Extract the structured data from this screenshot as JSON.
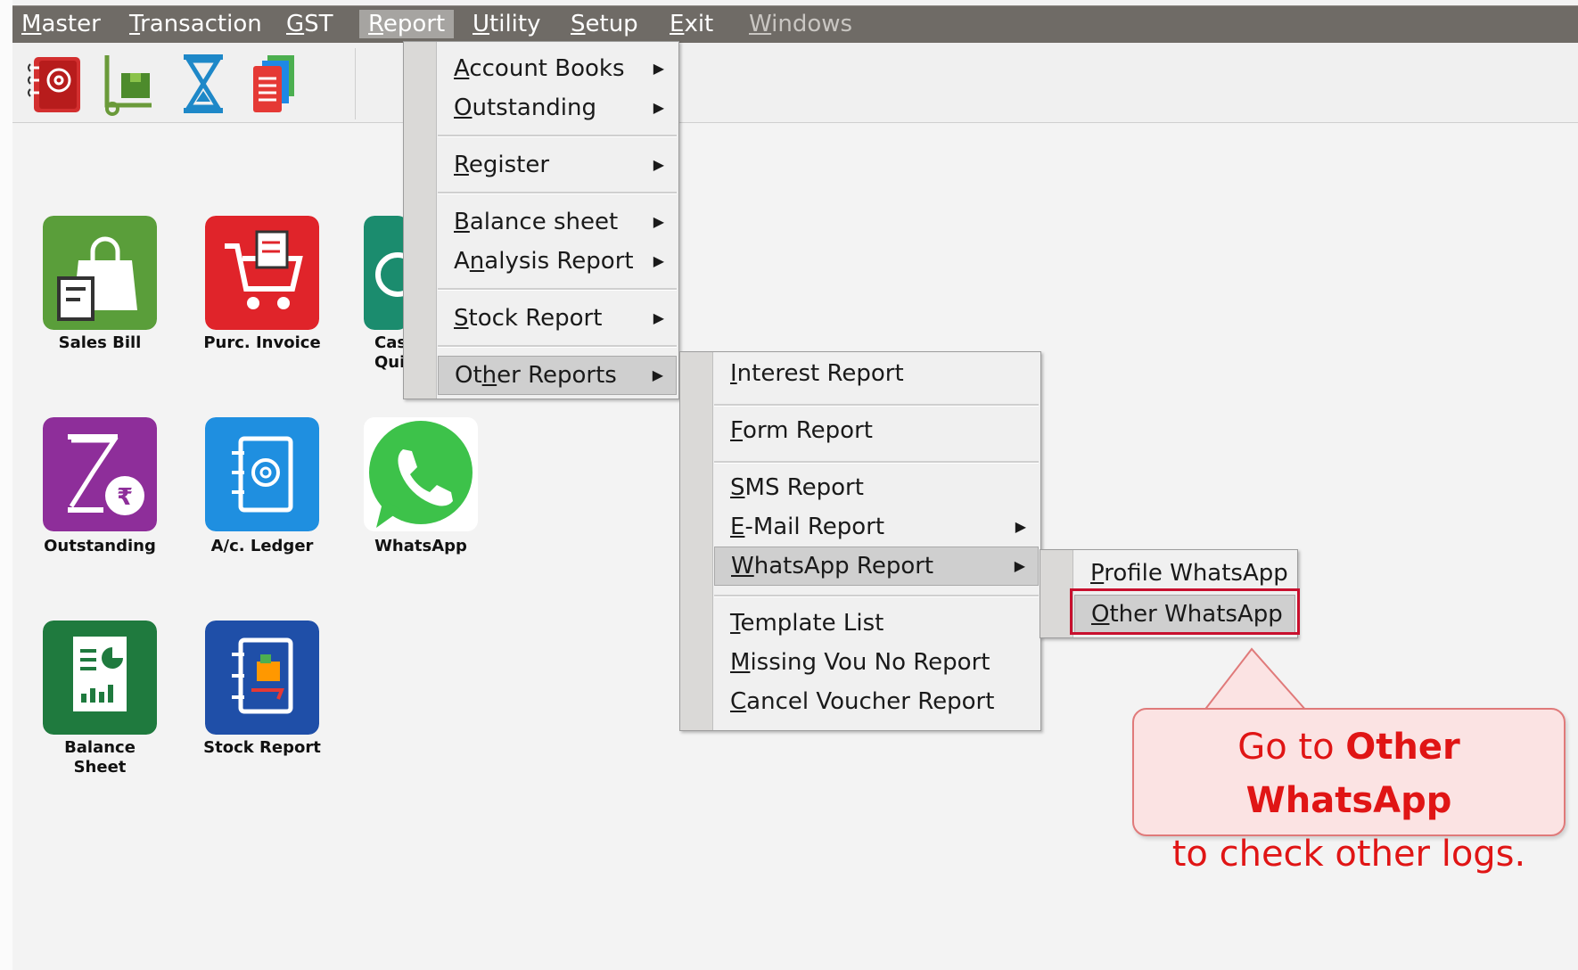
{
  "menubar": {
    "items": [
      {
        "label": "Master"
      },
      {
        "label": "Transaction"
      },
      {
        "label": "GST"
      },
      {
        "label": "Report"
      },
      {
        "label": "Utility"
      },
      {
        "label": "Setup"
      },
      {
        "label": "Exit"
      },
      {
        "label": "Windows"
      }
    ],
    "active": "Report"
  },
  "toolbar": {
    "icons": [
      "contacts-book-icon",
      "warehouse-stock-icon",
      "hourglass-icon",
      "reports-stack-icon"
    ]
  },
  "tiles": [
    {
      "label": "Sales Bill",
      "color": "#5a9e3a"
    },
    {
      "label": "Purc. Invoice",
      "color": "#e0242a"
    },
    {
      "label": "Cas",
      "label2": "Qui",
      "color": "#1b8c6e"
    },
    {
      "label": "Outstanding",
      "color": "#8e2e9a"
    },
    {
      "label": "A/c. Ledger",
      "color": "#1f8fe0"
    },
    {
      "label": "WhatsApp",
      "color": "#3dc24a"
    },
    {
      "label": "Balance",
      "label2": "Sheet",
      "color": "#1f7a3e"
    },
    {
      "label": "Stock Report",
      "color": "#1f4fa8"
    }
  ],
  "report_menu": {
    "items": [
      {
        "label": "Account Books",
        "key": "A"
      },
      {
        "label": "Outstanding",
        "key": "O"
      },
      {
        "label": "Register",
        "key": "R"
      },
      {
        "label": "Balance sheet",
        "key": "B"
      },
      {
        "label": "Analysis Report",
        "key": "n"
      },
      {
        "label": "Stock Report",
        "key": "S"
      },
      {
        "label": "Other Reports",
        "key": "h"
      }
    ]
  },
  "other_reports_menu": {
    "items": [
      {
        "label": "Interest Report",
        "key": "I"
      },
      {
        "label": "Form Report",
        "key": "F"
      },
      {
        "label": "SMS Report",
        "key": "S"
      },
      {
        "label": "E-Mail Report",
        "key": "E"
      },
      {
        "label": "WhatsApp Report",
        "key": "W"
      },
      {
        "label": "Template List",
        "key": "T"
      },
      {
        "label": "Missing Vou No Report",
        "key": "M"
      },
      {
        "label": "Cancel Voucher Report",
        "key": "C"
      }
    ]
  },
  "whatsapp_menu": {
    "items": [
      {
        "label": "Profile WhatsApp",
        "key": "P"
      },
      {
        "label": "Other WhatsApp",
        "key": "O"
      }
    ]
  },
  "callout": {
    "prefix": "Go to ",
    "bold": "Other WhatsApp",
    "line2": "to check other logs."
  }
}
